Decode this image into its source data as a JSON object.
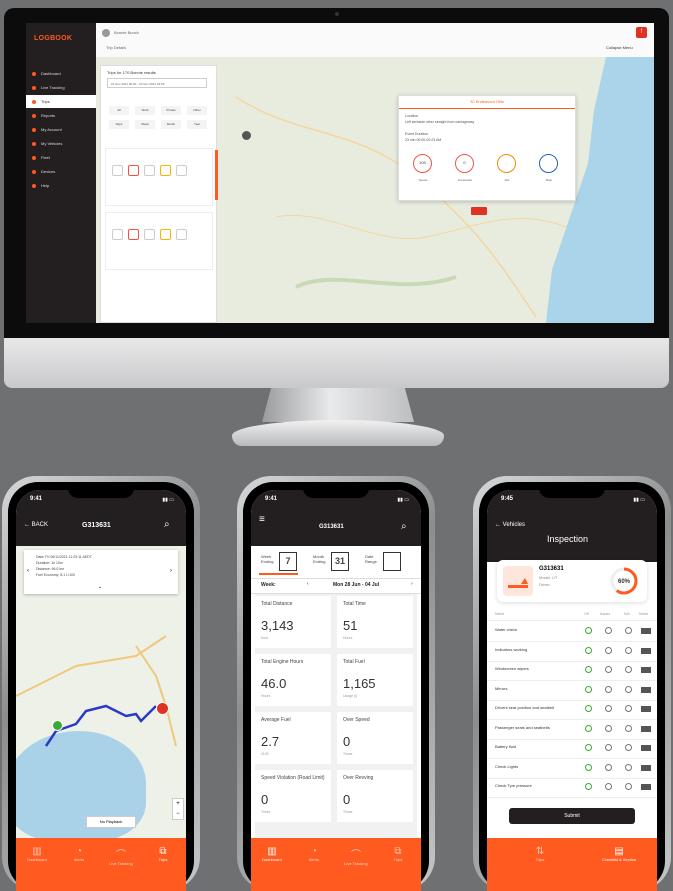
{
  "desktop": {
    "logo": "LOGBOOK",
    "nav": [
      "Dashboard",
      "Live Tracking",
      "Trips",
      "Reports",
      "My Account",
      "My Vehicles",
      "Fleet",
      "Devices",
      "Help"
    ],
    "user": "Bonnie Bunch",
    "breadcrumb": "Trip Details",
    "collapse_label": "Collapse Menu",
    "trip_label": "Trips for 170 Bonnie results",
    "trip_select": "01 Nov 2021 00:00 - 30 Nov 2021 23:59",
    "chips": [
      "All",
      "Work",
      "Private",
      "Other",
      "Days",
      "Week",
      "Month",
      "Year"
    ],
    "popup_title": "32 Endeavour Hills",
    "popup_lines": [
      "Location",
      "Left kerbside other straight from carriageway",
      "Event Duration",
      "23 min 00:00-00:23 AM"
    ],
    "gauges": [
      {
        "val": "100",
        "lab": "Speed"
      },
      {
        "val": "0",
        "lab": "Accelerate"
      },
      {
        "val": "",
        "lab": "Idle"
      },
      {
        "val": "",
        "lab": "Rain"
      }
    ]
  },
  "phone1": {
    "time": "9:41",
    "back": "BACK",
    "title": "G313631",
    "info": [
      "Date: Fri 06/11/2021 11:23:11 AEDT",
      "Duration: 1h 10m",
      "Distance: 96.0 km",
      "Fuel Economy: 8.1 L/100"
    ],
    "no_playback": "No Playback",
    "tabs": [
      "Dashboard",
      "Alerts",
      "Live Tracking",
      "Trips"
    ]
  },
  "phone2": {
    "time": "9:41",
    "title": "G313631",
    "periods": [
      {
        "label": "Week Ending",
        "icon": "7"
      },
      {
        "label": "Month Ending",
        "icon": "31"
      },
      {
        "label": "Date Range",
        "icon": ""
      }
    ],
    "week_label": "Week:",
    "week_range": "Mon 28 Jun - 04 Jul",
    "stats": [
      {
        "label": "Total Distance",
        "value": "3,143",
        "unit": "Kms"
      },
      {
        "label": "Total Time",
        "value": "51",
        "unit": "Hours"
      },
      {
        "label": "Total Engine Hours",
        "value": "46.0",
        "unit": "Hours"
      },
      {
        "label": "Total Fuel",
        "value": "1,165",
        "unit": "Usage (l)"
      },
      {
        "label": "Average Fuel",
        "value": "2.7",
        "unit": "l/100"
      },
      {
        "label": "Over Speed",
        "value": "0",
        "unit": "Times"
      },
      {
        "label": "Speed Violation (Road Limit)",
        "value": "0",
        "unit": "Times"
      },
      {
        "label": "Over Revving",
        "value": "0",
        "unit": "Times"
      }
    ],
    "tabs": [
      "Dashboard",
      "Alerts",
      "Live Tracking",
      "Trips"
    ]
  },
  "phone3": {
    "time": "9:45",
    "back": "Vehicles",
    "title": "Inspection",
    "vehicle": "G313631",
    "model": "Model: UT",
    "driver": "Driver:",
    "progress": "60%",
    "progress_value": 0.6,
    "columns": [
      "Name",
      "OK",
      "Issues",
      "N/A",
      "Notes"
    ],
    "items": [
      "Water check",
      "Indicators working",
      "Windscreen wipers",
      "Mirrors",
      "Drivers seat position and seatbelt",
      "Passenger seats and seatbelts",
      "Battery fluid",
      "Check Lights",
      "Check Tyre pressure"
    ],
    "submit": "Submit",
    "tabs": [
      "Trips",
      "Checklist & Service"
    ]
  },
  "colors": {
    "accent": "#ff5a1f",
    "dark": "#231f20",
    "ok": "#3aaa35"
  }
}
